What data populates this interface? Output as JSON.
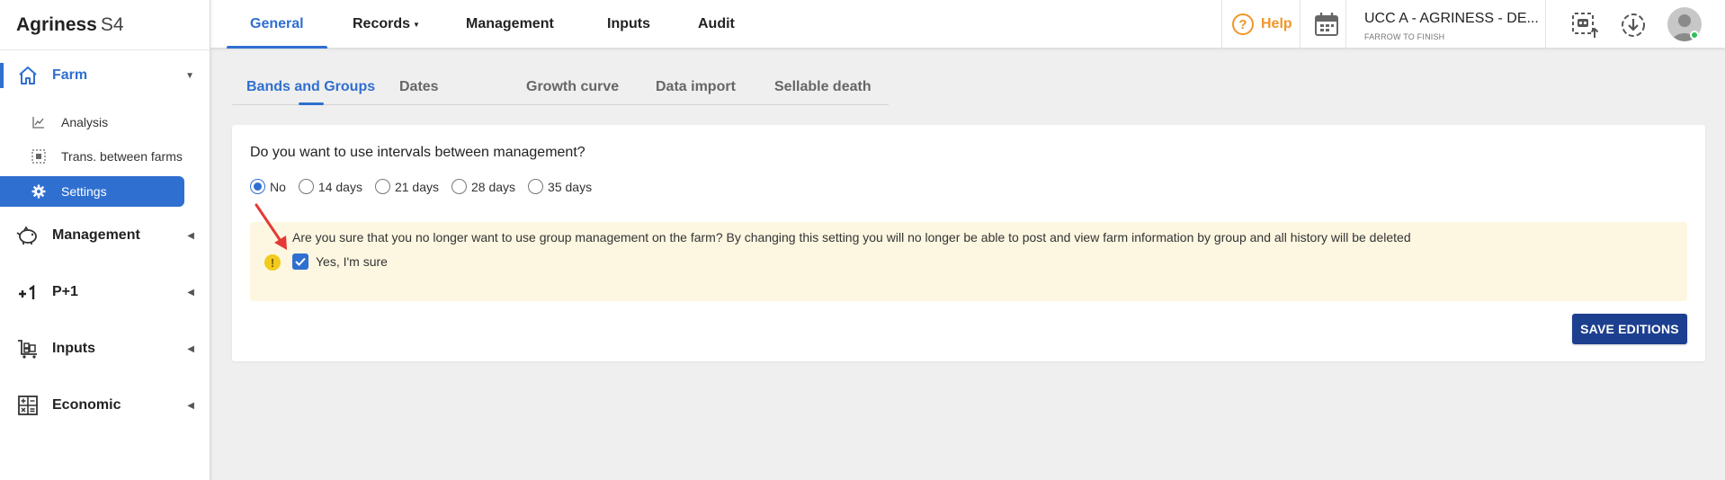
{
  "app": {
    "name": "Agriness",
    "version": "S4"
  },
  "topnav": {
    "tabs": [
      {
        "label": "General",
        "active": true
      },
      {
        "label": "Records",
        "dropdown": true
      },
      {
        "label": "Management"
      },
      {
        "label": "Inputs"
      },
      {
        "label": "Audit"
      }
    ],
    "help_label": "Help",
    "farm_name": "UCC A - AGRINESS - DE...",
    "farm_type": "FARROW TO FINISH"
  },
  "sidebar": {
    "items": [
      {
        "label": "Farm",
        "icon": "home-icon",
        "expanded": true,
        "children": [
          {
            "label": "Analysis",
            "icon": "chart-line-icon"
          },
          {
            "label": "Trans. between farms",
            "icon": "transfer-icon"
          },
          {
            "label": "Settings",
            "icon": "gear-icon",
            "selected": true
          }
        ]
      },
      {
        "label": "Management",
        "icon": "piggy-icon"
      },
      {
        "label": "P+1",
        "icon": "plus-one-icon"
      },
      {
        "label": "Inputs",
        "icon": "cart-icon"
      },
      {
        "label": "Economic",
        "icon": "calculator-icon"
      }
    ]
  },
  "subtabs": [
    {
      "label": "Bands and Groups",
      "active": true
    },
    {
      "label": "Dates"
    },
    {
      "label": "Growth curve"
    },
    {
      "label": "Data import"
    },
    {
      "label": "Sellable death"
    }
  ],
  "form": {
    "question": "Do you want to use intervals between management?",
    "options": [
      {
        "label": "No",
        "selected": true
      },
      {
        "label": "14 days"
      },
      {
        "label": "21 days"
      },
      {
        "label": "28 days"
      },
      {
        "label": "35 days"
      }
    ],
    "warning": {
      "text": "Are you sure that you no longer want to use group management on the farm? By changing this setting you will no longer be able to post and view farm information by group and all history will be deleted",
      "checkbox_label": "Yes, I'm sure",
      "checked": true
    },
    "save_label": "SAVE EDITIONS"
  },
  "colors": {
    "accent": "#2f6fd0",
    "save_button": "#1d3f8f",
    "help": "#f0962a",
    "warning_bg": "#fdf7e1",
    "annotation_arrow": "#e53935"
  }
}
